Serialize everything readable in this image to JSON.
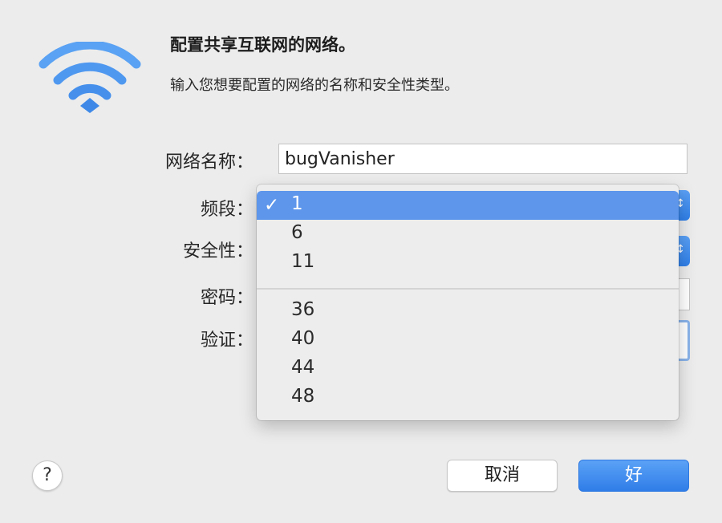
{
  "dialog": {
    "title": "配置共享互联网的网络。",
    "subtitle": "输入您想要配置的网络的名称和安全性类型。"
  },
  "form": {
    "network_name_label": "网络名称：",
    "network_name_value": "bugVanisher",
    "channel_label": "频段：",
    "security_label": "安全性：",
    "password_label": "密码：",
    "verify_label": "验证："
  },
  "channel_menu": {
    "selected": "1",
    "check_mark": "✓",
    "group1": [
      "1",
      "6",
      "11"
    ],
    "group2": [
      "36",
      "40",
      "44",
      "48"
    ]
  },
  "buttons": {
    "help": "?",
    "cancel": "取消",
    "ok": "好"
  },
  "colors": {
    "accent": "#3d8bef",
    "menu_highlight": "#5d96eb",
    "background": "#ececec"
  },
  "icons": {
    "wifi": "wifi-icon",
    "popup_chevron": "chevron-updown-icon"
  }
}
